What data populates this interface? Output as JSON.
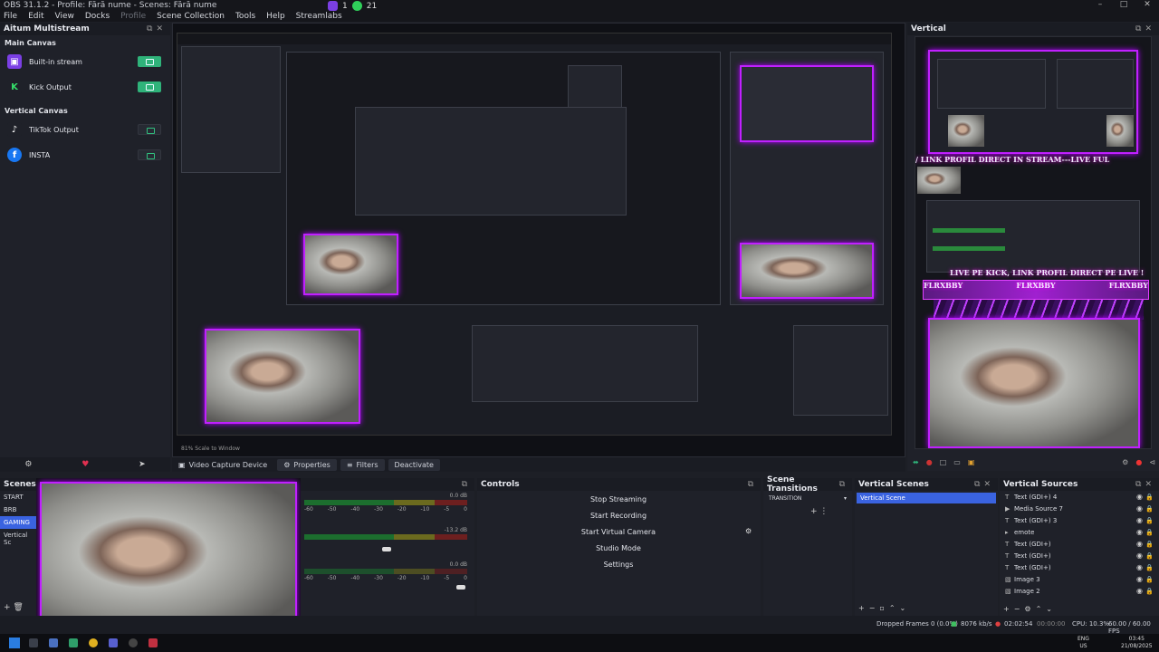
{
  "window": {
    "title": "OBS 31.1.2 - Profile: Fără nume - Scenes: Fără nume",
    "controls": [
      "–",
      "□",
      "✕"
    ]
  },
  "twitch_bar": {
    "count_a": "1",
    "count_b": "21"
  },
  "menu": {
    "items": [
      "File",
      "Edit",
      "View",
      "Docks",
      "Profile",
      "Scene Collection",
      "Tools",
      "Help",
      "Streamlabs"
    ]
  },
  "multistream": {
    "title": "Aitum Multistream",
    "main_canvas_label": "Main Canvas",
    "vertical_canvas_label": "Vertical Canvas",
    "main_outputs": [
      {
        "name": "Built-in stream",
        "icon": "twitch-icon"
      },
      {
        "name": "Kick Output",
        "icon": "kick-icon"
      }
    ],
    "vertical_outputs": [
      {
        "name": "TikTok Output",
        "icon": "tiktok-icon"
      },
      {
        "name": "INSTA",
        "icon": "facebook-icon"
      }
    ]
  },
  "preview": {
    "zoom_label": "81%",
    "scale_label": "Scale to Window"
  },
  "vertical_panel": {
    "title": "Vertical",
    "banner_top": "/ LINK PROFIL DIRECT IN STREAM---LIVE FUL",
    "banner_mid": "LIVE PE KICK, LINK PROFIL DIRECT PE LIVE !",
    "tags": [
      "FLRXBBY",
      "FLRXBBY",
      "FLRXBBY"
    ]
  },
  "source_toolbar": {
    "device": "Video Capture Device",
    "properties": "Properties",
    "filters": "Filters",
    "deactivate": "Deactivate"
  },
  "scenes": {
    "title": "Scenes",
    "items": [
      "START",
      "BRB",
      "GAMING",
      "Vertical Sc"
    ],
    "selected": "GAMING"
  },
  "mixer": {
    "levels": [
      "0.0 dB",
      "-13.2 dB",
      "0.0 dB"
    ],
    "tick_labels": [
      "-60",
      "-50",
      "-40",
      "-30",
      "-20",
      "-10",
      "-5",
      "0"
    ]
  },
  "controls": {
    "title": "Controls",
    "buttons": [
      "Stop Streaming",
      "Start Recording",
      "Start Virtual Camera",
      "Studio Mode",
      "Settings"
    ]
  },
  "transitions": {
    "title": "Scene Transitions",
    "selected": "TRANSITION"
  },
  "vertical_scenes": {
    "title": "Vertical Scenes",
    "items": [
      "Vertical Scene"
    ]
  },
  "vertical_sources": {
    "title": "Vertical Sources",
    "items": [
      "Text (GDI+) 4",
      "Media Source 7",
      "Text (GDI+) 3",
      "emote",
      "Text (GDI+)",
      "Text (GDI+)",
      "Text (GDI+)",
      "Image 3",
      "Image 2"
    ]
  },
  "status": {
    "dropped": "Dropped Frames 0 (0.0%)",
    "bitrate": "8076 kb/s",
    "live_time": "02:02:54",
    "rec_time": "00:00:00",
    "cpu": "CPU: 10.3%",
    "fps": "60.00 / 60.00 FPS"
  },
  "taskbar": {
    "lang": "ENG",
    "region": "US",
    "time": "03:45",
    "date": "21/08/2025"
  },
  "colors": {
    "accent": "#3a63e0",
    "neon": "#c020ff",
    "toggle_on": "#2fb37a"
  }
}
